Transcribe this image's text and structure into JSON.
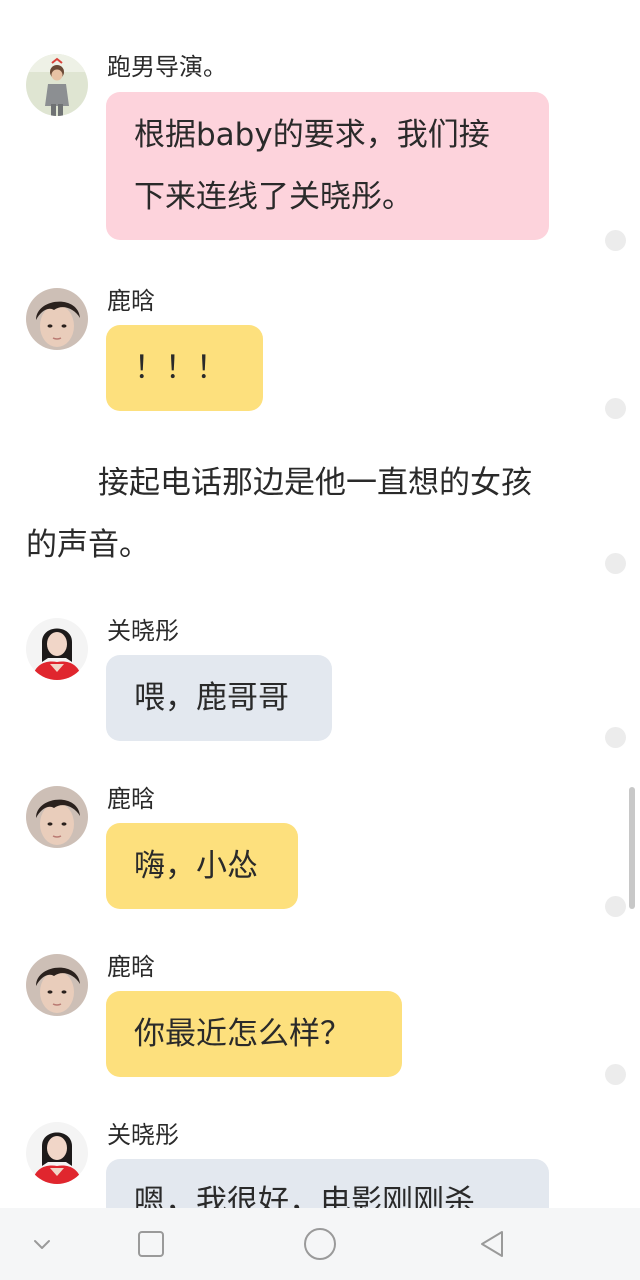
{
  "messages": [
    {
      "sender": "跑男导演。",
      "text_lines": [
        "根据baby的要求，我们接",
        "下来连线了关晓彤。"
      ]
    },
    {
      "sender": "鹿晗",
      "text_lines": [
        "！！！"
      ]
    },
    {
      "sender": "关晓彤",
      "text_lines": [
        "喂，鹿哥哥"
      ]
    },
    {
      "sender": "鹿晗",
      "text_lines": [
        "嗨，小怂"
      ]
    },
    {
      "sender": "鹿晗",
      "text_lines": [
        "你最近怎么样？"
      ]
    },
    {
      "sender": "关晓彤",
      "text_lines": [
        "嗯，我很好，电影刚刚杀"
      ]
    }
  ],
  "narration_lines": [
    "接起电话那边是他一直想的女孩",
    "的声音。"
  ],
  "colors": {
    "bubble_director": "#fdd3dc",
    "bubble_luhan": "#fde07d",
    "bubble_guan": "#e3e8ef",
    "navbar_bg": "#f5f6f7"
  },
  "navbar": {
    "icons": [
      "chevron-down-icon",
      "recent-apps-icon",
      "home-icon",
      "back-icon"
    ]
  }
}
